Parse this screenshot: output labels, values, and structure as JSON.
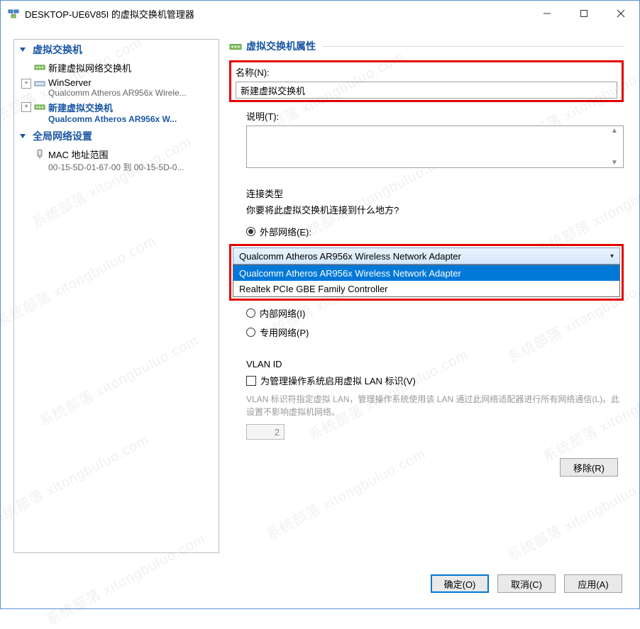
{
  "window": {
    "title": "DESKTOP-UE6V85I 的虚拟交换机管理器"
  },
  "tree": {
    "section1": {
      "header": "虚拟交换机",
      "newSwitch": "新建虚拟网络交换机",
      "winserver": {
        "name": "WinServer",
        "sub": "Qualcomm Atheros AR956x Wirele..."
      },
      "selected": {
        "name": "新建虚拟交换机",
        "sub": "Qualcomm Atheros AR956x W..."
      }
    },
    "section2": {
      "header": "全局网络设置",
      "mac": {
        "name": "MAC 地址范围",
        "sub": "00-15-5D-01-67-00 到 00-15-5D-0..."
      }
    }
  },
  "right": {
    "header": "虚拟交换机属性",
    "nameLabel": "名称(N):",
    "nameValue": "新建虚拟交换机",
    "descLabel": "说明(T):",
    "connTypeHeader": "连接类型",
    "connTypeQuestion": "你要将此虚拟交换机连接到什么地方?",
    "radioExternal": "外部网络(E):",
    "comboSelected": "Qualcomm Atheros AR956x Wireless Network Adapter",
    "comboOpt1": "Qualcomm Atheros AR956x Wireless Network Adapter",
    "comboOpt2": "Realtek PCIe GBE Family Controller",
    "radioInternal": "内部网络(I)",
    "radioPrivate": "专用网络(P)",
    "vlanHeader": "VLAN ID",
    "vlanCheckbox": "为管理操作系统启用虚拟 LAN 标识(V)",
    "vlanDesc": "VLAN 标识符指定虚拟 LAN，管理操作系统使用该 LAN 通过此网络适配器进行所有网络通信(L)。此设置不影响虚拟机网络。",
    "vlanValue": "2",
    "removeBtn": "移除(R)"
  },
  "footer": {
    "ok": "确定(O)",
    "cancel": "取消(C)",
    "apply": "应用(A)"
  },
  "watermark": "系统部落 xitongbuluo.com"
}
